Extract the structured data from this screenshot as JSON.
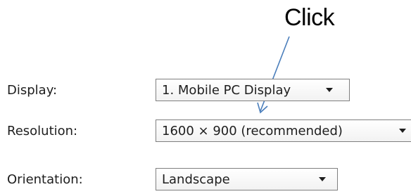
{
  "annotation": {
    "text": "Click"
  },
  "settings": {
    "rows": [
      {
        "label": "Display:",
        "value": "1. Mobile PC Display"
      },
      {
        "label": "Resolution:",
        "value": "1600 × 900 (recommended)"
      },
      {
        "label": "Orientation:",
        "value": "Landscape"
      }
    ]
  },
  "colors": {
    "annotation_arrow": "#4a7ebb",
    "combo_border": "#7f7f7f",
    "text": "#1e1e1e"
  },
  "icons": {
    "dropdown": "triangle-down-icon"
  }
}
